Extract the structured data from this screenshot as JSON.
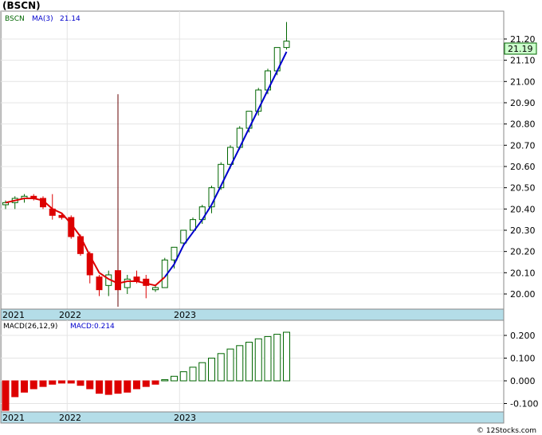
{
  "header": {
    "ticker_title": "(BSCN)",
    "legend_symbol": "BSCN",
    "legend_ma_label": "MA(3)",
    "legend_ma_value": "21.14",
    "macd_label": "MACD(26,12,9)",
    "macd_value_label": "MACD:0.214"
  },
  "price_axis": {
    "ticks": [
      "21.20",
      "21.10",
      "21.00",
      "20.90",
      "20.80",
      "20.70",
      "20.60",
      "20.50",
      "20.40",
      "20.30",
      "20.20",
      "20.10",
      "20.00"
    ],
    "last_price": "21.19"
  },
  "macd_axis": {
    "ticks": [
      "0.200",
      "0.100",
      "0.000",
      "-0.100"
    ]
  },
  "time_axis": {
    "labels": [
      "2021",
      "2022",
      "2023"
    ]
  },
  "watermark": "© 12Stocks.com",
  "colors": {
    "up": "#006600",
    "down": "#dd0000",
    "ma_early": "#dd0000",
    "ma_late": "#0000cc",
    "axis_band": "#b4dde8",
    "last_box": "#ccffcc",
    "macd_label": "#0000cc",
    "legend_symbol": "#006600"
  },
  "chart_data": [
    {
      "type": "candlestick",
      "title": "(BSCN)",
      "series_name": "BSCN",
      "ylim": [
        19.95,
        21.3
      ],
      "grid": true,
      "candles": [
        {
          "o": 20.42,
          "h": 20.44,
          "l": 20.4,
          "c": 20.43
        },
        {
          "o": 20.43,
          "h": 20.46,
          "l": 20.4,
          "c": 20.45
        },
        {
          "o": 20.45,
          "h": 20.47,
          "l": 20.43,
          "c": 20.46
        },
        {
          "o": 20.46,
          "h": 20.47,
          "l": 20.44,
          "c": 20.45
        },
        {
          "o": 20.45,
          "h": 20.46,
          "l": 20.4,
          "c": 20.41
        },
        {
          "o": 20.4,
          "h": 20.47,
          "l": 20.35,
          "c": 20.37
        },
        {
          "o": 20.37,
          "h": 20.38,
          "l": 20.35,
          "c": 20.36
        },
        {
          "o": 20.36,
          "h": 20.37,
          "l": 20.26,
          "c": 20.27
        },
        {
          "o": 20.27,
          "h": 20.28,
          "l": 20.18,
          "c": 20.19
        },
        {
          "o": 20.19,
          "h": 20.2,
          "l": 20.05,
          "c": 20.09
        },
        {
          "o": 20.08,
          "h": 20.09,
          "l": 19.99,
          "c": 20.02
        },
        {
          "o": 20.04,
          "h": 20.11,
          "l": 19.99,
          "c": 20.09
        },
        {
          "o": 20.11,
          "h": 20.94,
          "l": 19.94,
          "c": 20.02
        },
        {
          "o": 20.03,
          "h": 20.09,
          "l": 20.0,
          "c": 20.07
        },
        {
          "o": 20.08,
          "h": 20.11,
          "l": 20.05,
          "c": 20.06
        },
        {
          "o": 20.07,
          "h": 20.09,
          "l": 19.98,
          "c": 20.04
        },
        {
          "o": 20.02,
          "h": 20.04,
          "l": 20.01,
          "c": 20.03
        },
        {
          "o": 20.03,
          "h": 20.17,
          "l": 20.03,
          "c": 20.16
        },
        {
          "o": 20.16,
          "h": 20.22,
          "l": 20.12,
          "c": 20.22
        },
        {
          "o": 20.24,
          "h": 20.3,
          "l": 20.23,
          "c": 20.3
        },
        {
          "o": 20.3,
          "h": 20.36,
          "l": 20.3,
          "c": 20.35
        },
        {
          "o": 20.35,
          "h": 20.42,
          "l": 20.33,
          "c": 20.41
        },
        {
          "o": 20.41,
          "h": 20.51,
          "l": 20.38,
          "c": 20.5
        },
        {
          "o": 20.5,
          "h": 20.62,
          "l": 20.49,
          "c": 20.61
        },
        {
          "o": 20.61,
          "h": 20.7,
          "l": 20.59,
          "c": 20.69
        },
        {
          "o": 20.69,
          "h": 20.79,
          "l": 20.68,
          "c": 20.78
        },
        {
          "o": 20.78,
          "h": 20.86,
          "l": 20.76,
          "c": 20.86
        },
        {
          "o": 20.86,
          "h": 20.97,
          "l": 20.84,
          "c": 20.96
        },
        {
          "o": 20.96,
          "h": 21.06,
          "l": 20.94,
          "c": 21.05
        },
        {
          "o": 21.05,
          "h": 21.16,
          "l": 21.03,
          "c": 21.16
        },
        {
          "o": 21.16,
          "h": 21.28,
          "l": 21.15,
          "c": 21.19
        }
      ],
      "ma_label": "MA(3)",
      "ma": [
        20.43,
        20.44,
        20.45,
        20.45,
        20.44,
        20.4,
        20.38,
        20.33,
        20.27,
        20.18,
        20.1,
        20.07,
        20.05,
        20.06,
        20.06,
        20.05,
        20.04,
        20.08,
        20.14,
        20.23,
        20.29,
        20.35,
        20.42,
        20.51,
        20.6,
        20.69,
        20.78,
        20.87,
        20.96,
        21.05,
        21.14
      ],
      "ma_color_switch_index": 17
    },
    {
      "type": "bar",
      "title": "MACD(26,12,9)",
      "ylim": [
        -0.14,
        0.25
      ],
      "values": [
        -0.13,
        -0.07,
        -0.05,
        -0.035,
        -0.025,
        -0.015,
        -0.01,
        -0.01,
        -0.02,
        -0.035,
        -0.055,
        -0.06,
        -0.055,
        -0.05,
        -0.035,
        -0.025,
        -0.015,
        0.005,
        0.02,
        0.04,
        0.06,
        0.08,
        0.1,
        0.12,
        0.14,
        0.155,
        0.17,
        0.185,
        0.195,
        0.205,
        0.214
      ],
      "x_labels": [
        "2021",
        "2022",
        "2023"
      ]
    }
  ]
}
